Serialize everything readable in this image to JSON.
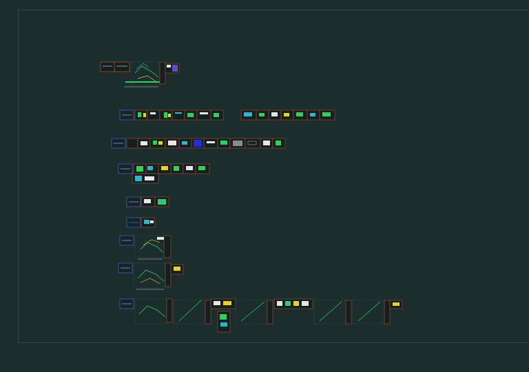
{
  "colors": {
    "background": "#1c2d2d",
    "border": "#2f4a46",
    "frame": "#b24a2e",
    "label": "#3b62b8",
    "green": "#2ed15a",
    "yellow": "#e8d21a",
    "cyan": "#2ab6d1",
    "blue": "#2030d8",
    "white": "#e6e6e6"
  },
  "rows": [
    {
      "id": "r1",
      "captions": [
        "",
        "",
        ""
      ]
    },
    {
      "id": "r2",
      "captions": [
        ""
      ]
    },
    {
      "id": "r3",
      "captions": [
        ""
      ]
    },
    {
      "id": "r4",
      "captions": [
        ""
      ]
    },
    {
      "id": "r5",
      "captions": [
        ""
      ]
    },
    {
      "id": "r6",
      "captions": [
        ""
      ]
    },
    {
      "id": "r7",
      "captions": [
        ""
      ]
    },
    {
      "id": "r8",
      "captions": [
        ""
      ]
    },
    {
      "id": "r9",
      "captions": [
        ""
      ]
    }
  ]
}
